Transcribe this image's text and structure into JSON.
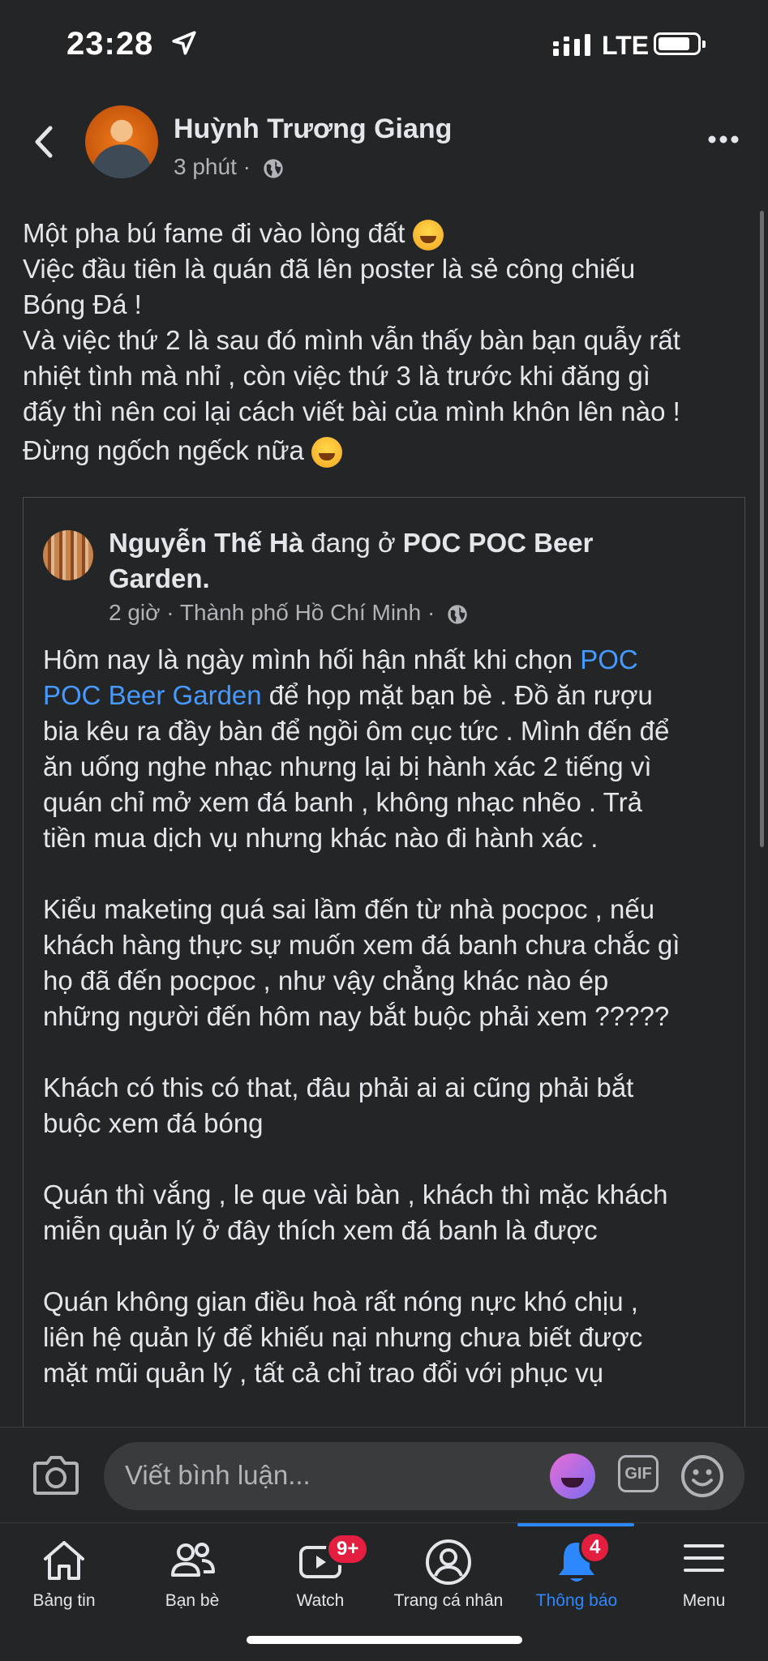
{
  "status_bar": {
    "time": "23:28",
    "network": "LTE"
  },
  "post": {
    "author": "Huỳnh Trương Giang",
    "time": "3 phút",
    "separator": "·",
    "lines": [
      "Một pha bú fame đi vào lòng đất",
      "Việc đầu tiên là quán đã lên poster là sẻ công chiếu",
      "Bóng Đá !",
      "Và việc thứ 2 là sau đó mình vẫn thấy bàn bạn quẫy rất",
      "nhiệt tình mà nhỉ , còn việc thứ 3 là trước khi đăng gì",
      "đấy thì nên coi lại cách viết bài của mình khôn lên nào !",
      "Đừng ngốch ngếck nữa"
    ]
  },
  "shared_post": {
    "author": "Nguyễn Thế Hà",
    "verb": " đang ở ",
    "place_line1": "POC POC Beer",
    "place_line2": "Garden.",
    "time": "2 giờ",
    "location": "Thành phố Hồ Chí Minh",
    "separator": "·",
    "p1_start": "Hôm nay là ngày mình hối hận nhất khi chọn ",
    "p1_link1": "POC",
    "p1_link2": "POC Beer Garden",
    "p1_rest": " để họp mặt bạn bè . Đồ ăn rượu",
    "p1_lines": [
      "bia kêu ra đầy bàn để ngồi ôm cục tức . Mình đến để",
      "ăn uống nghe nhạc nhưng lại bị hành xác 2 tiếng vì",
      "quán chỉ mở xem đá banh , không nhạc nhẽo  . Trả",
      "tiền mua dịch vụ nhưng khác nào đi hành xác ."
    ],
    "p2_lines": [
      "Kiểu maketing quá sai lầm đến từ nhà pocpoc , nếu",
      "khách hàng thực sự muốn xem đá banh chưa chắc gì",
      "họ đã đến pocpoc , như vậy chẳng khác nào ép",
      "những người đến hôm nay bắt buộc phải xem ?????"
    ],
    "p3_lines": [
      "Khách có this có that, đâu phải ai ai cũng phải bắt",
      "buộc xem đá bóng"
    ],
    "p4_lines": [
      "Quán thì vắng , le que vài bàn , khách thì mặc khách",
      "miễn quản lý ở đây thích xem đá banh là được"
    ],
    "p5_lines": [
      "Quán không gian điều hoà rất nóng nực khó chịu ,",
      "liên hệ quản lý để khiếu nại nhưng chưa biết được",
      "mặt mũi quản lý , tất cả chỉ trao đổi với phục vụ"
    ]
  },
  "comment": {
    "placeholder": "Viết bình luận...",
    "gif_label": "GIF"
  },
  "tabs": [
    {
      "label": "Bảng tin",
      "icon": "home-icon"
    },
    {
      "label": "Bạn bè",
      "icon": "friends-icon"
    },
    {
      "label": "Watch",
      "icon": "watch-icon",
      "badge": "9+"
    },
    {
      "label": "Trang cá nhân",
      "icon": "profile-icon"
    },
    {
      "label": "Thông báo",
      "icon": "bell-icon",
      "badge": "4",
      "active": true
    },
    {
      "label": "Menu",
      "icon": "menu-icon"
    }
  ],
  "colors": {
    "background": "#242526",
    "link": "#4599ff",
    "active_tab": "#2d88ff",
    "badge": "#e41e3f"
  }
}
